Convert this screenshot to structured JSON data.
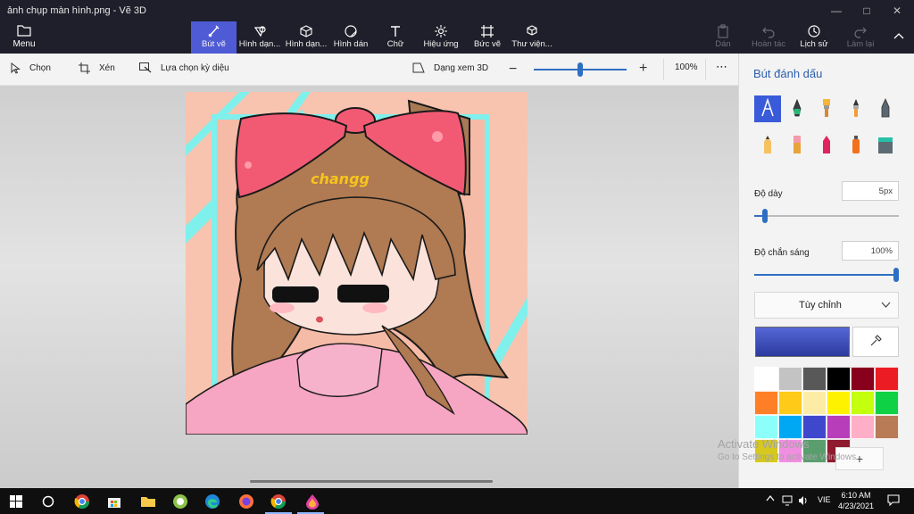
{
  "window": {
    "title": "ảnh chụp màn hình.png - Vẽ 3D",
    "minimize_icon": "minimize-icon",
    "maximize_icon": "maximize-icon",
    "close_icon": "close-icon"
  },
  "ribbon": {
    "menu_label": "Menu",
    "tools": [
      {
        "label": "Bút vẽ",
        "icon": "brush-icon",
        "active": true
      },
      {
        "label": "Hình dạn...",
        "icon": "2d-shapes-icon"
      },
      {
        "label": "Hình dạn...",
        "icon": "3d-shapes-icon"
      },
      {
        "label": "Hình dán",
        "icon": "stickers-icon"
      },
      {
        "label": "Chữ",
        "icon": "text-icon"
      },
      {
        "label": "Hiệu ứng",
        "icon": "effects-icon"
      },
      {
        "label": "Bức vẽ",
        "icon": "canvas-icon"
      },
      {
        "label": "Thư viện...",
        "icon": "library-icon"
      }
    ],
    "actions": [
      {
        "label": "Dán",
        "icon": "paste-icon",
        "enabled": false
      },
      {
        "label": "Hoàn tác",
        "icon": "undo-icon",
        "enabled": false
      },
      {
        "label": "Lịch sử",
        "icon": "history-icon",
        "enabled": true
      },
      {
        "label": "Làm lại",
        "icon": "redo-icon",
        "enabled": false
      }
    ],
    "collapse_icon": "chevron-up-icon"
  },
  "subtoolbar": {
    "select_label": "Chọn",
    "crop_label": "Xén",
    "magic_select_label": "Lựa chọn kỳ diệu",
    "view_3d_label": "Dạng xem 3D",
    "zoom_value": "100%",
    "zoom_level": 0.5,
    "more_icon": "more-icon"
  },
  "canvas": {
    "sticker_text": "changg",
    "colors": {
      "background": "#f8c4b0",
      "stripes": "#7ff0ec",
      "hair": "#b07a52",
      "bow": "#f25a74",
      "shirt": "#f6a6c2"
    }
  },
  "panel": {
    "title": "Bút đánh dấu",
    "brushes": [
      {
        "name": "marker",
        "icon": "marker-icon",
        "selected": true
      },
      {
        "name": "calligraphy pen",
        "icon": "calligraphy-pen-icon"
      },
      {
        "name": "oil brush",
        "icon": "oil-brush-icon"
      },
      {
        "name": "watercolor",
        "icon": "watercolor-icon"
      },
      {
        "name": "pixel pen",
        "icon": "pixel-pen-icon"
      },
      {
        "name": "pencil",
        "icon": "pencil-icon"
      },
      {
        "name": "eraser",
        "icon": "eraser-icon"
      },
      {
        "name": "crayon",
        "icon": "crayon-icon"
      },
      {
        "name": "spray can",
        "icon": "spray-can-icon"
      },
      {
        "name": "fill",
        "icon": "fill-bucket-icon"
      }
    ],
    "thickness_label": "Độ dày",
    "thickness_value": "5px",
    "thickness_level": 0.06,
    "opacity_label": "Độ chắn sáng",
    "opacity_value": "100%",
    "opacity_level": 1.0,
    "custom_label": "Tùy chỉnh",
    "current_color": "#3d4cc0",
    "eyedropper_icon": "eyedropper-icon",
    "add_color_symbol": "+",
    "palette": [
      "#ffffff",
      "#c3c3c3",
      "#585858",
      "#000000",
      "#88001b",
      "#ec1c24",
      "#ff7f27",
      "#ffca18",
      "#fdeca6",
      "#fff200",
      "#c4ff0e",
      "#0ed145",
      "#8cfffb",
      "#00a8f3",
      "#3f48cc",
      "#b83dba",
      "#ffaec8",
      "#b97a56",
      "#d6c81e",
      "#f08ee0",
      "#5a9e6e",
      "#8e1b2e"
    ]
  },
  "watermark": {
    "line1": "Activate Windows",
    "line2": "Go to Settings to activate Windows."
  },
  "taskbar": {
    "apps": [
      "start-icon",
      "cortana-icon",
      "chrome-icon",
      "store-icon",
      "file-explorer-icon",
      "app-green-icon",
      "edge-icon",
      "firefox-icon",
      "chrome-active-icon",
      "paint3d-icon"
    ],
    "tray_lang": "VIE",
    "time": "6:10 AM",
    "date": "4/23/2021"
  }
}
